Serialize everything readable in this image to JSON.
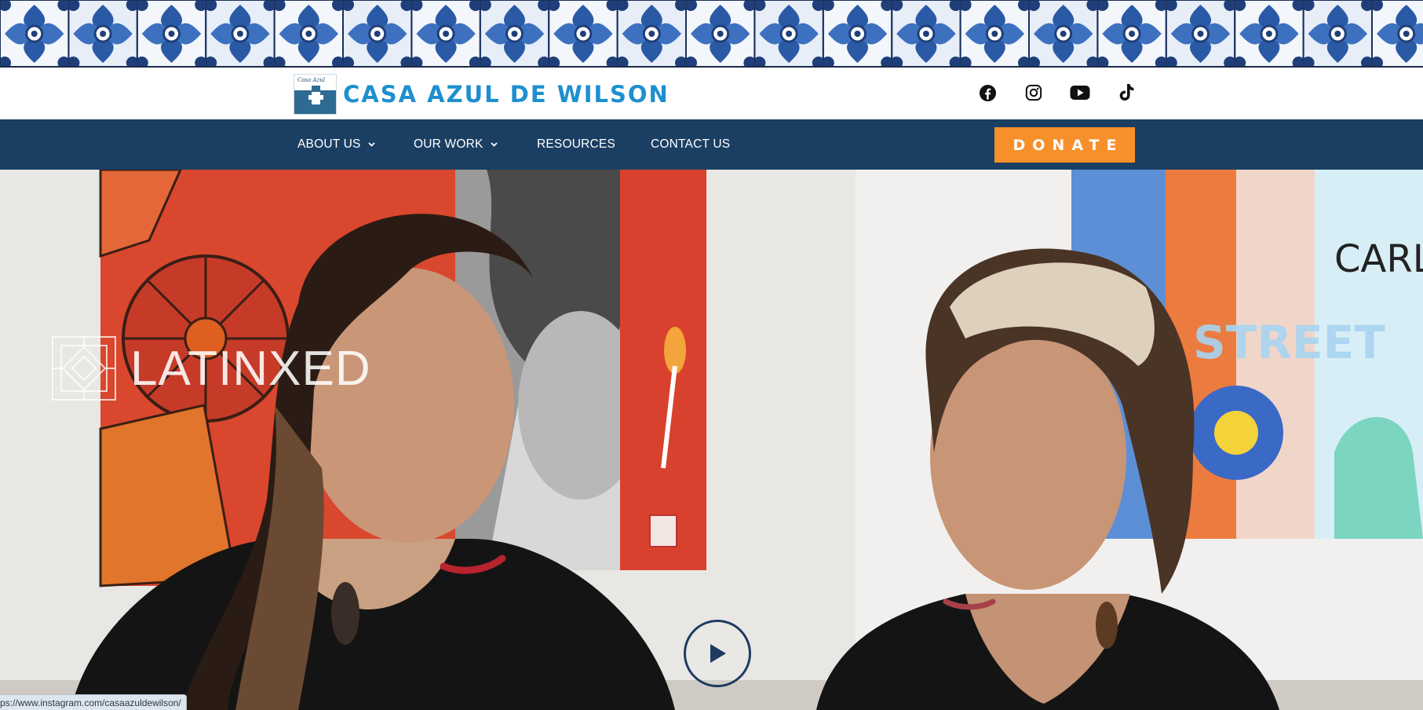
{
  "header": {
    "site_title": "CASA AZUL DE WILSON",
    "logo_text": "Casa Azul",
    "social": {
      "facebook": "facebook-icon",
      "instagram": "instagram-icon",
      "youtube": "youtube-icon",
      "tiktok": "tiktok-icon"
    }
  },
  "nav": {
    "items": [
      {
        "label": "ABOUT US",
        "has_dropdown": true
      },
      {
        "label": "OUR WORK",
        "has_dropdown": true
      },
      {
        "label": "RESOURCES",
        "has_dropdown": false
      },
      {
        "label": "CONTACT US",
        "has_dropdown": false
      }
    ],
    "donate_label": "DONATE"
  },
  "hero": {
    "brand_overlay": "LATINXED",
    "play_icon": "play-icon"
  },
  "status_bar": {
    "url": "ps://www.instagram.com/casaazuldewilson/"
  },
  "colors": {
    "brand_blue": "#1e8fcf",
    "nav_bg": "#1b3f63",
    "donate_orange": "#f7902b",
    "tile_blue": "#1f3f7a"
  }
}
